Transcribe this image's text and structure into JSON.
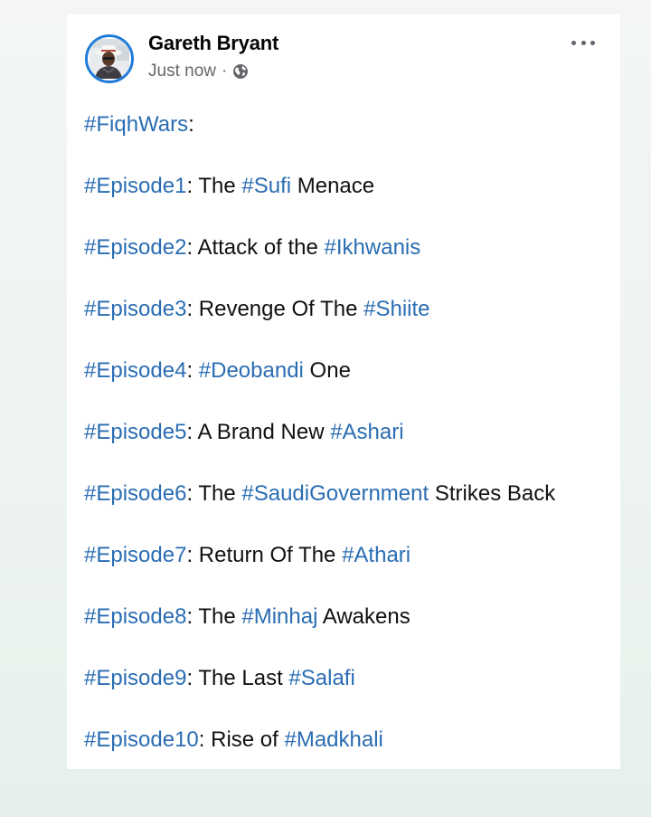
{
  "post": {
    "author": "Gareth Bryant",
    "timestamp": "Just now",
    "separator": "·",
    "privacy_icon": "globe-icon",
    "menu_icon": "more-options-icon",
    "colors": {
      "hashtag": "#2a6db3",
      "text": "#111111",
      "avatar_ring": "#1f7bd9",
      "meta": "#65676b"
    },
    "lines": [
      {
        "hashtag": "#FiqhWars",
        "colon": ":",
        "pre": "",
        "tag2": "",
        "post": ""
      },
      {
        "hashtag": "#Episode1",
        "colon": ":",
        "pre": " The ",
        "tag2": "#Sufi",
        "post": " Menace"
      },
      {
        "hashtag": "#Episode2",
        "colon": ":",
        "pre": " Attack of the ",
        "tag2": "#Ikhwanis",
        "post": ""
      },
      {
        "hashtag": "#Episode3",
        "colon": ":",
        "pre": " Revenge Of The ",
        "tag2": "#Shiite",
        "post": ""
      },
      {
        "hashtag": "#Episode4",
        "colon": ":",
        "pre": " ",
        "tag2": "#Deobandi",
        "post": " One"
      },
      {
        "hashtag": "#Episode5",
        "colon": ":",
        "pre": " A Brand New ",
        "tag2": "#Ashari",
        "post": ""
      },
      {
        "hashtag": "#Episode6",
        "colon": ":",
        "pre": " The ",
        "tag2": "#SaudiGovernment",
        "post": " Strikes Back"
      },
      {
        "hashtag": "#Episode7",
        "colon": ":",
        "pre": " Return Of The ",
        "tag2": "#Athari",
        "post": ""
      },
      {
        "hashtag": "#Episode8",
        "colon": ":",
        "pre": " The ",
        "tag2": "#Minhaj",
        "post": " Awakens"
      },
      {
        "hashtag": "#Episode9",
        "colon": ":",
        "pre": " The Last ",
        "tag2": "#Salafi",
        "post": ""
      },
      {
        "hashtag": "#Episode10",
        "colon": ":",
        "pre": " Rise of ",
        "tag2": "#Madkhali",
        "post": ""
      }
    ]
  }
}
